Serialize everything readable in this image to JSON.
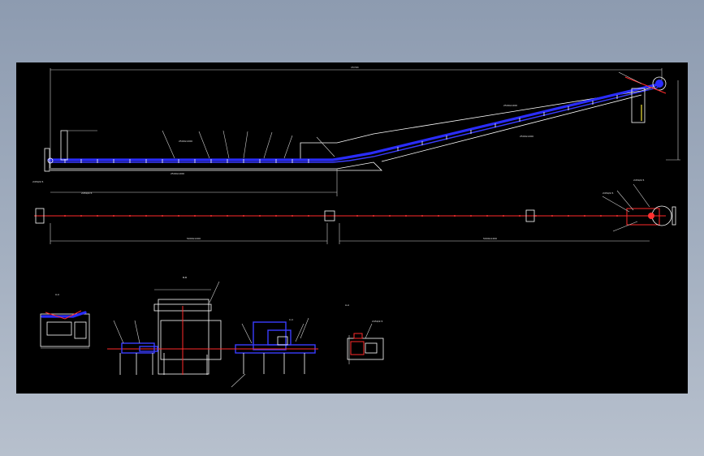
{
  "drawing": {
    "background": "#000000",
    "colors": {
      "belt": "#2a2cff",
      "centerline": "#ff2a2a",
      "outline": "#ffffff",
      "dimension": "#cfcfcf",
      "accent": "#f2e23a"
    }
  },
  "labels": {
    "side_label_1": "2450/2.5",
    "side_label_2": "2450/2.5",
    "head_label_1": "2450/2.5",
    "head_label_2": "2450/2.5",
    "detail_label": "2450/2.5",
    "detail_title": "A-A",
    "section_a": "A-A",
    "section_b": "B-B",
    "section_c": "C-C"
  }
}
